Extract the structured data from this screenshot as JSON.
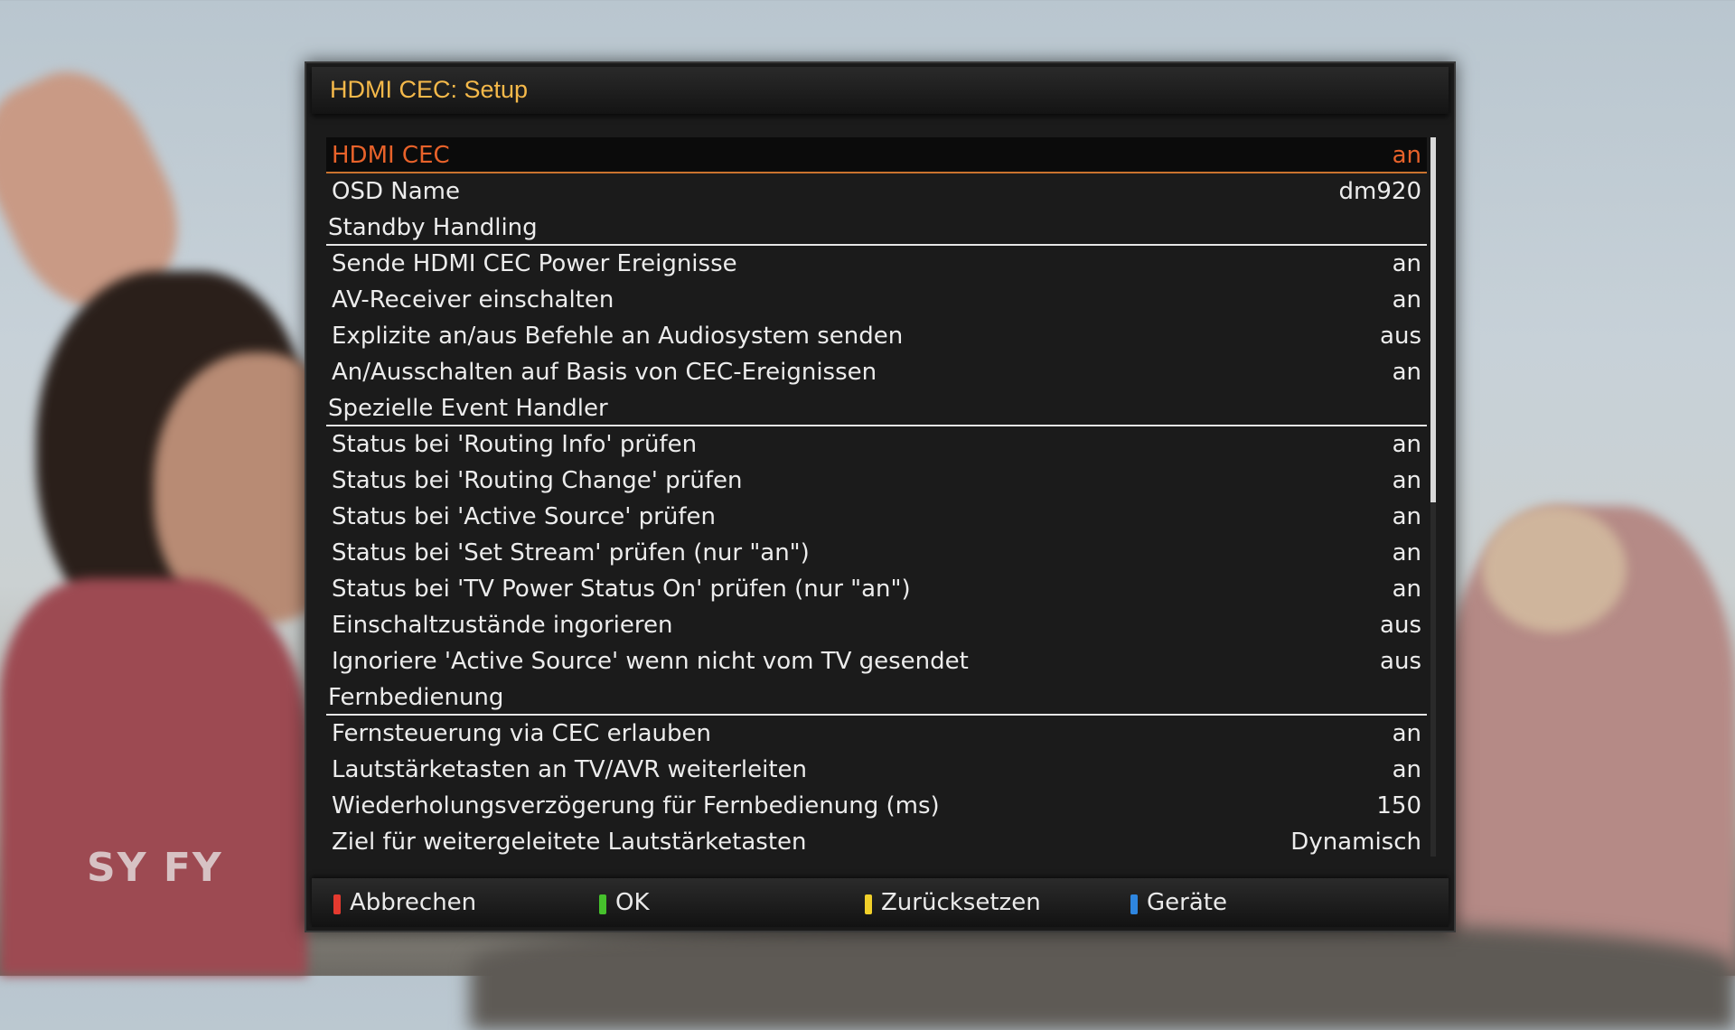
{
  "window": {
    "title": "HDMI CEC: Setup"
  },
  "background": {
    "channel_logo": "SY FY"
  },
  "menu": {
    "rows": [
      {
        "type": "item",
        "label": "HDMI CEC",
        "value": "an",
        "selected": true
      },
      {
        "type": "item",
        "label": "OSD Name",
        "value": "dm920"
      },
      {
        "type": "section",
        "label": "Standby Handling"
      },
      {
        "type": "item",
        "label": "Sende HDMI CEC Power Ereignisse",
        "value": "an"
      },
      {
        "type": "item",
        "label": "AV-Receiver einschalten",
        "value": "an"
      },
      {
        "type": "item",
        "label": "Explizite an/aus Befehle an Audiosystem senden",
        "value": "aus"
      },
      {
        "type": "item",
        "label": "An/Ausschalten auf Basis von CEC-Ereignissen",
        "value": "an"
      },
      {
        "type": "section",
        "label": "Spezielle Event Handler"
      },
      {
        "type": "item",
        "label": "Status bei 'Routing Info' prüfen",
        "value": "an"
      },
      {
        "type": "item",
        "label": "Status bei 'Routing Change' prüfen",
        "value": "an"
      },
      {
        "type": "item",
        "label": "Status bei 'Active Source' prüfen",
        "value": "an"
      },
      {
        "type": "item",
        "label": "Status bei 'Set Stream' prüfen (nur \"an\")",
        "value": "an"
      },
      {
        "type": "item",
        "label": "Status bei 'TV Power Status On' prüfen (nur \"an\")",
        "value": "an"
      },
      {
        "type": "item",
        "label": "Einschaltzustände ingorieren",
        "value": "aus"
      },
      {
        "type": "item",
        "label": "Ignoriere 'Active Source' wenn nicht vom TV gesendet",
        "value": "aus"
      },
      {
        "type": "section",
        "label": "Fernbedienung"
      },
      {
        "type": "item",
        "label": "Fernsteuerung via CEC erlauben",
        "value": "an"
      },
      {
        "type": "item",
        "label": "Lautstärketasten an TV/AVR weiterleiten",
        "value": "an"
      },
      {
        "type": "item",
        "label": "Wiederholungsverzögerung für Fernbedienung (ms)",
        "value": "150"
      },
      {
        "type": "item",
        "label": "Ziel für weitergeleitete Lautstärketasten",
        "value": "Dynamisch"
      }
    ]
  },
  "footer": {
    "buttons": [
      {
        "name": "red-button",
        "label": "Abbrechen",
        "color": "#e53a2f"
      },
      {
        "name": "green-button",
        "label": "OK",
        "color": "#46c12c"
      },
      {
        "name": "yellow-button",
        "label": "Zurücksetzen",
        "color": "#f1d02a"
      },
      {
        "name": "blue-button",
        "label": "Geräte",
        "color": "#2e86e0"
      }
    ]
  },
  "colors": {
    "title": "#f5b94a",
    "selected_text": "#e8622a",
    "text": "#ececec"
  }
}
